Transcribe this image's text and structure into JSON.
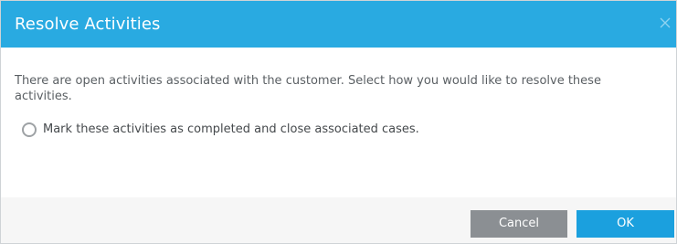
{
  "dialog": {
    "title": "Resolve Activities",
    "close_icon": "close-icon",
    "message": "There are open activities associated with the customer. Select how you would like to resolve these activities.",
    "option_label": "Mark these activities as completed and close associated cases.",
    "option_selected": false,
    "cancel_label": "Cancel",
    "ok_label": "OK"
  },
  "colors": {
    "header": "#29aae1",
    "cancel_button": "#8b8f93",
    "ok_button": "#1ba0de",
    "footer": "#f6f6f6"
  }
}
